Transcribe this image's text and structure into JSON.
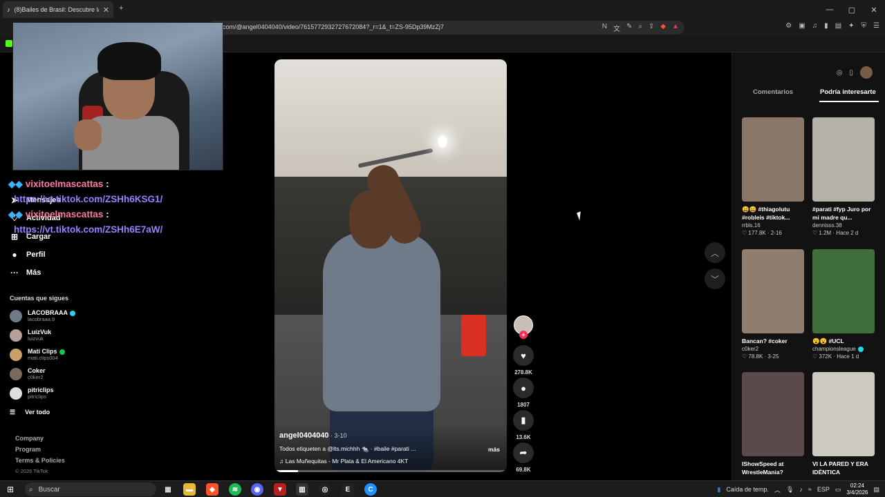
{
  "browser": {
    "tab_title": "(8)Bailes de Brasil: Descubre las",
    "tab_close": "✕",
    "new_tab": "+",
    "url": "com/@angel0404040/video/7615772932727672084?_r=1&_t=ZS-95Dp39MzZj7",
    "window_controls": [
      "—",
      "▢",
      "✕"
    ]
  },
  "chat_overlay": {
    "messages": [
      {
        "badges": "◆◆",
        "user": "vixitoelmascattas",
        "colon": ":",
        "link": "https://vt.tiktok.com/ZSHh6KSG1/"
      },
      {
        "badges": "◆◆",
        "user": "vixitoelmascattas",
        "colon": ":",
        "link": "https://vt.tiktok.com/ZSHh6E7aW/"
      }
    ]
  },
  "sidebar": {
    "items": [
      {
        "label": "Mensajes",
        "icon": "send-icon",
        "glyph": "➤"
      },
      {
        "label": "Actividad",
        "icon": "activity-icon",
        "glyph": "♡"
      },
      {
        "label": "Cargar",
        "icon": "upload-icon",
        "glyph": "⊞"
      },
      {
        "label": "Perfil",
        "icon": "profile-icon",
        "glyph": "●"
      },
      {
        "label": "Más",
        "icon": "more-icon",
        "glyph": "···"
      }
    ],
    "following_title": "Cuentas que sigues",
    "following": [
      {
        "name": "LACOBRAAA",
        "handle": "lacobraaa.9",
        "badge": "verified",
        "color": "#6e7a86"
      },
      {
        "name": "LuizVuk",
        "handle": "luizvuk",
        "badge": "",
        "color": "#b79f9a"
      },
      {
        "name": "Mati Clips",
        "handle": "mati.clips004",
        "badge": "online",
        "color": "#c7a06a"
      },
      {
        "name": "Coker",
        "handle": "c0ker2",
        "badge": "",
        "color": "#7b6a5c"
      },
      {
        "name": "pitriclips",
        "handle": "pitriclips",
        "badge": "",
        "color": "#dddddd"
      }
    ],
    "see_all": "Ver todo",
    "footer_links": [
      "Company",
      "Program",
      "Terms & Policies"
    ],
    "copyright": "© 2026 TikTok"
  },
  "video": {
    "author": "angel0404040",
    "date": " · 3-10",
    "caption": "Todos etiqueten a @lts.michhh 🐀 · #baile #parati ...",
    "more": "más",
    "music": "♫  Las Muñequitas - Mr Plata & El Americano 4KT",
    "progress": 0.1
  },
  "actions": {
    "plus": "+",
    "likes": "278.8K",
    "comments": "1807",
    "saves": "13.6K",
    "shares": "69.8K"
  },
  "right_panel": {
    "tabs": [
      "Comentarios",
      "Podría interesarte"
    ],
    "cards": [
      {
        "title": "😄😄 #thiagolutu #robleis #tiktok...",
        "author": "rrbls.16",
        "stats": "♡ 177.8K · 2-16",
        "color": "#8a7769"
      },
      {
        "title": "#parati #fyp Juro por mi madre qu...",
        "author": "dennisss.38",
        "stats": "♡ 1.2M · Hace 2 d",
        "color": "#b5b0a8"
      },
      {
        "title": "Bancan? #coker",
        "author": "c0ker2",
        "stats": "♡ 78.8K · 3-25",
        "color": "#8f7e70"
      },
      {
        "title": "😮😮 #UCL",
        "author": "championsleague",
        "stats": "♡ 372K · Hace 1 d",
        "color": "#3f6e3a"
      },
      {
        "title": "IShowSpeed at WrestleMania?",
        "author": "",
        "stats": "",
        "color": "#5a4a4a"
      },
      {
        "title": "VI LA PARED Y ERA IDÉNTICA",
        "author": "",
        "stats": "",
        "color": "#cfcac0"
      }
    ]
  },
  "taskbar": {
    "search_placeholder": "Buscar",
    "weather": "Caída de temp.",
    "lang": "ESP",
    "time": "02:24",
    "date": "3/4/2026"
  }
}
